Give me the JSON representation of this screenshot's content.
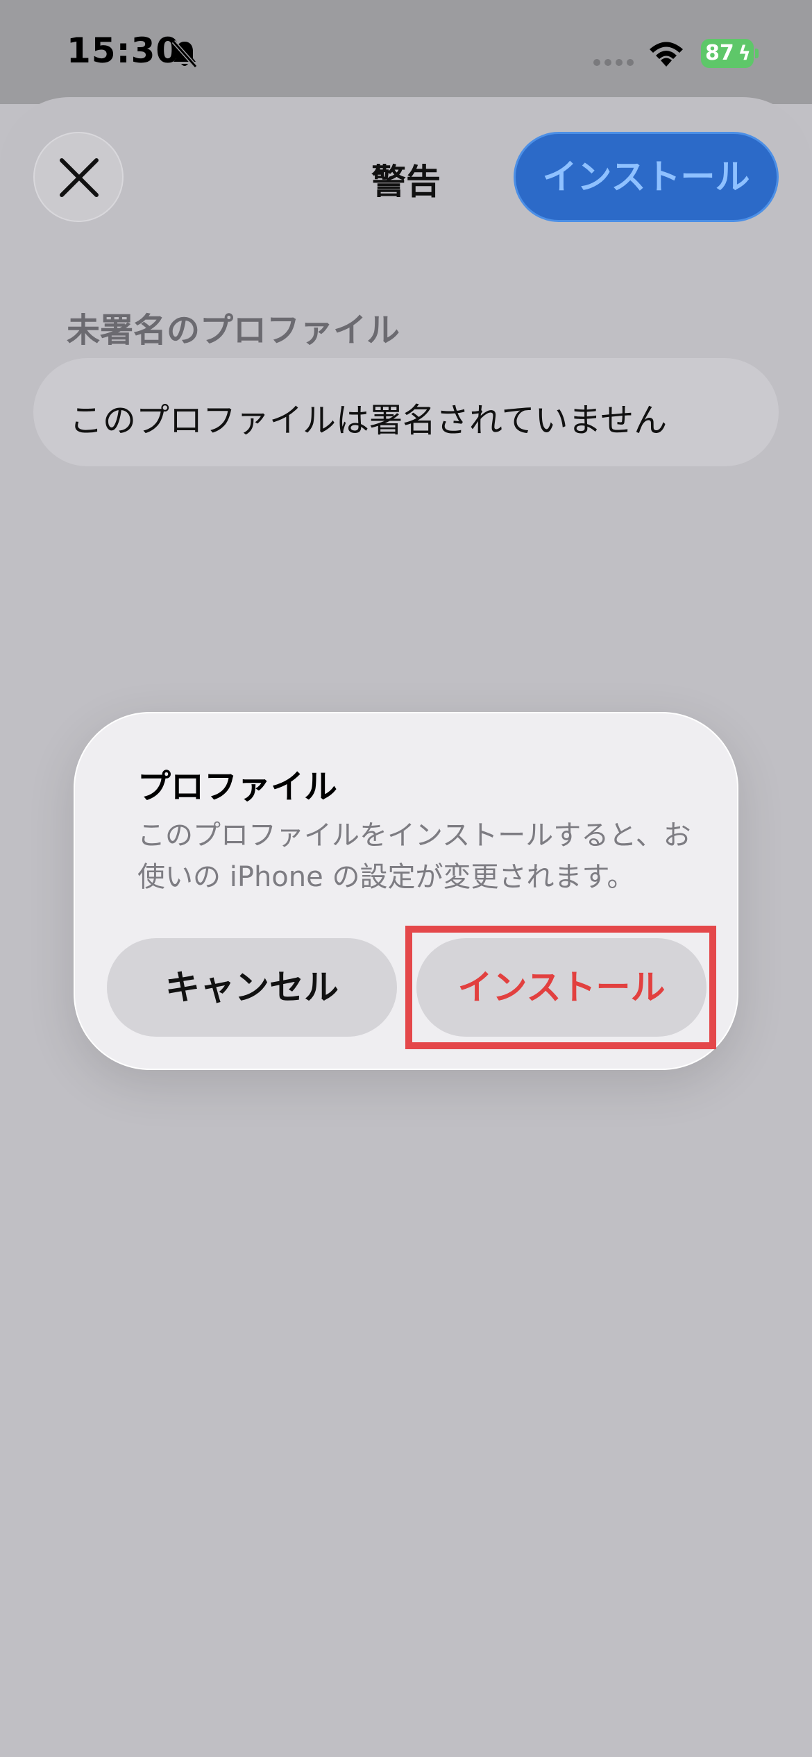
{
  "status_bar": {
    "time": "15:30",
    "battery": "87",
    "icons": [
      "bell-slash-icon",
      "signal-icon",
      "wifi-icon",
      "battery-charging-icon"
    ]
  },
  "nav": {
    "title": "警告",
    "install_label": "インストール",
    "close_icon": "close-icon"
  },
  "section": {
    "header": "未署名のプロファイル",
    "row_text": "このプロファイルは署名されていません"
  },
  "alert": {
    "title": "プロファイル",
    "message": "このプロファイルをインストールすると、お使いの iPhone の設定が変更されます。",
    "cancel_label": "キャンセル",
    "install_label": "インストール"
  },
  "colors": {
    "accent_blue": "#2c6ac8",
    "destructive_red": "#e2403f",
    "highlight_red": "#e4474a"
  }
}
